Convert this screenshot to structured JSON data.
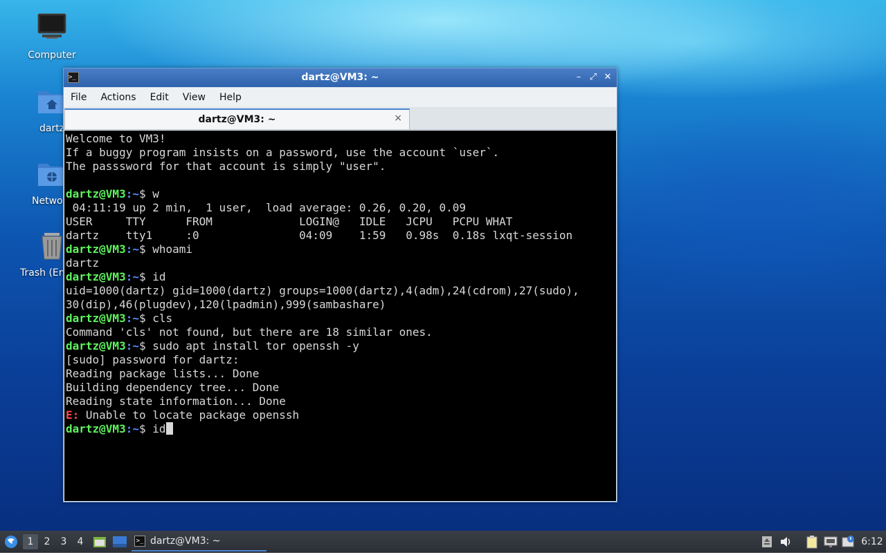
{
  "desktop": {
    "icons": [
      {
        "label": "Computer"
      },
      {
        "label": "dartz"
      },
      {
        "label": "Netwo"
      },
      {
        "label": "Trash (Em"
      }
    ]
  },
  "window": {
    "title": "dartz@VM3: ~",
    "buttons": {
      "minimize": "–",
      "maximize": "⤢",
      "close": "✕"
    }
  },
  "menu": [
    "File",
    "Actions",
    "Edit",
    "View",
    "Help"
  ],
  "tab": {
    "label": "dartz@VM3: ~",
    "close": "×"
  },
  "terminal": {
    "prompt_user": "dartz@VM3",
    "prompt_path": ":~",
    "prompt_sym": "$ ",
    "lines": [
      {
        "type": "text",
        "text": "Welcome to VM3!"
      },
      {
        "type": "text",
        "text": "If a buggy program insists on a password, use the account `user`."
      },
      {
        "type": "text",
        "text": "The passsword for that account is simply \"user\"."
      },
      {
        "type": "text",
        "text": ""
      },
      {
        "type": "prompt",
        "cmd": "w"
      },
      {
        "type": "text",
        "text": " 04:11:19 up 2 min,  1 user,  load average: 0.26, 0.20, 0.09"
      },
      {
        "type": "text",
        "text": "USER     TTY      FROM             LOGIN@   IDLE   JCPU   PCPU WHAT"
      },
      {
        "type": "text",
        "text": "dartz    tty1     :0               04:09    1:59   0.98s  0.18s lxqt-session"
      },
      {
        "type": "prompt",
        "cmd": "whoami"
      },
      {
        "type": "text",
        "text": "dartz"
      },
      {
        "type": "prompt",
        "cmd": "id"
      },
      {
        "type": "text",
        "text": "uid=1000(dartz) gid=1000(dartz) groups=1000(dartz),4(adm),24(cdrom),27(sudo),"
      },
      {
        "type": "text",
        "text": "30(dip),46(plugdev),120(lpadmin),999(sambashare)"
      },
      {
        "type": "prompt",
        "cmd": "cls"
      },
      {
        "type": "text",
        "text": "Command 'cls' not found, but there are 18 similar ones."
      },
      {
        "type": "prompt",
        "cmd": "sudo apt install tor openssh -y"
      },
      {
        "type": "text",
        "text": "[sudo] password for dartz:"
      },
      {
        "type": "text",
        "text": "Reading package lists... Done"
      },
      {
        "type": "text",
        "text": "Building dependency tree... Done"
      },
      {
        "type": "text",
        "text": "Reading state information... Done"
      },
      {
        "type": "error",
        "label": "E:",
        "text": " Unable to locate package openssh"
      },
      {
        "type": "prompt",
        "cmd": "id",
        "cursor": true
      }
    ]
  },
  "taskbar": {
    "desktops": [
      "1",
      "2",
      "3",
      "4"
    ],
    "active_desktop": "1",
    "task_label": "dartz@VM3: ~",
    "clock": "6:12"
  }
}
